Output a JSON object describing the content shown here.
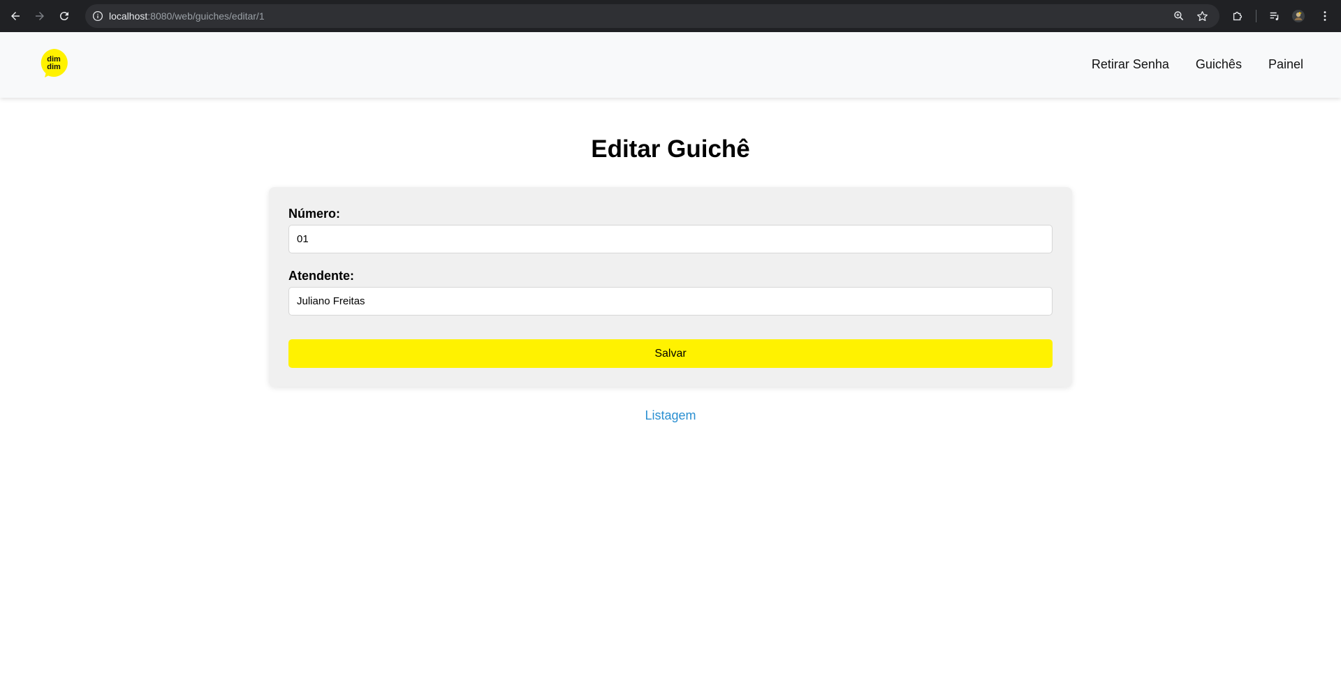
{
  "browser": {
    "url_host": "localhost",
    "url_rest": ":8080/web/guiches/editar/1",
    "icons": [
      "back-icon",
      "forward-icon",
      "reload-icon",
      "info-icon",
      "zoom-icon",
      "star-icon",
      "extensions-icon",
      "media-icon",
      "profile-icon",
      "menu-icon"
    ]
  },
  "header": {
    "logo_text_top": "dim",
    "logo_text_bottom": "dim",
    "logo_color": "#fff200",
    "nav": [
      {
        "label": "Retirar Senha"
      },
      {
        "label": "Guichês"
      },
      {
        "label": "Painel"
      }
    ]
  },
  "main": {
    "title": "Editar Guichê",
    "form": {
      "numero_label": "Número:",
      "numero_value": "01",
      "atendente_label": "Atendente:",
      "atendente_value": "Juliano Freitas",
      "save_label": "Salvar"
    },
    "list_link": "Listagem"
  },
  "colors": {
    "accent": "#fff200",
    "link": "#2a8fd1",
    "card_bg": "#f0f0f0"
  }
}
